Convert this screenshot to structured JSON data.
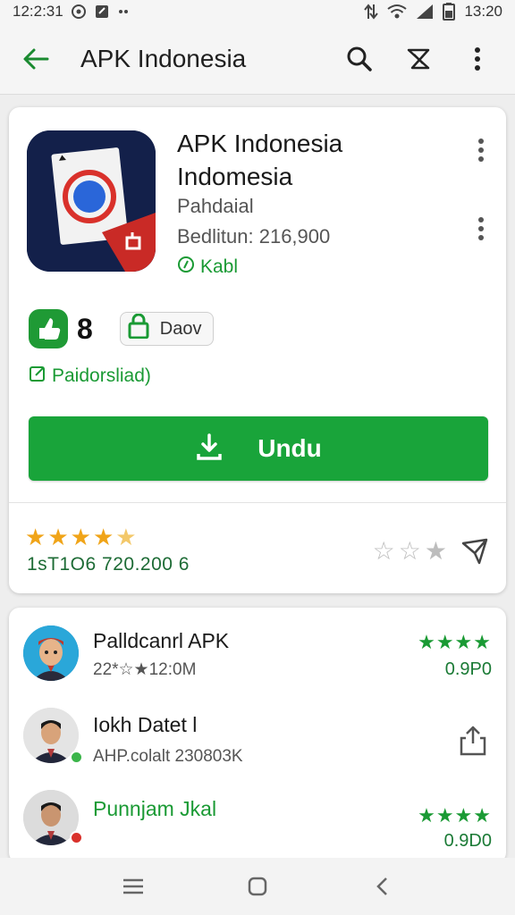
{
  "status_bar": {
    "time_left": "12:2:31",
    "time_right": "13:20"
  },
  "app_bar": {
    "title": "APK Indonesia"
  },
  "app": {
    "name_line1": "APK Indonesia",
    "name_line2": "Indomesia",
    "developer": "Pahdaial",
    "downloads": "Bedlitun: 216,900",
    "verified": "Kabl",
    "rating_number": "8",
    "chip_label": "Daov",
    "pending_label": "Paidorsliad)",
    "install_label": "Undu",
    "stars_value": "4.5 of 5",
    "stats_text": "1sT1O6 720.200 6",
    "accent_color": "#19a43a"
  },
  "list": [
    {
      "title": "Palldcanrl APK",
      "subtitle": "22*☆★​12:0M",
      "stars": "★★★★",
      "value": "0.9P0",
      "avatar": "cartoon-avatar"
    },
    {
      "title": "Iokh Datet l",
      "subtitle": "AHP.colalt  230803K",
      "share": "share-icon",
      "avatar": "person-avatar"
    },
    {
      "title": "Punnjam Jkal",
      "subtitle": "",
      "stars": "★★★★",
      "value": "0.9D0",
      "avatar": "person-avatar"
    }
  ]
}
